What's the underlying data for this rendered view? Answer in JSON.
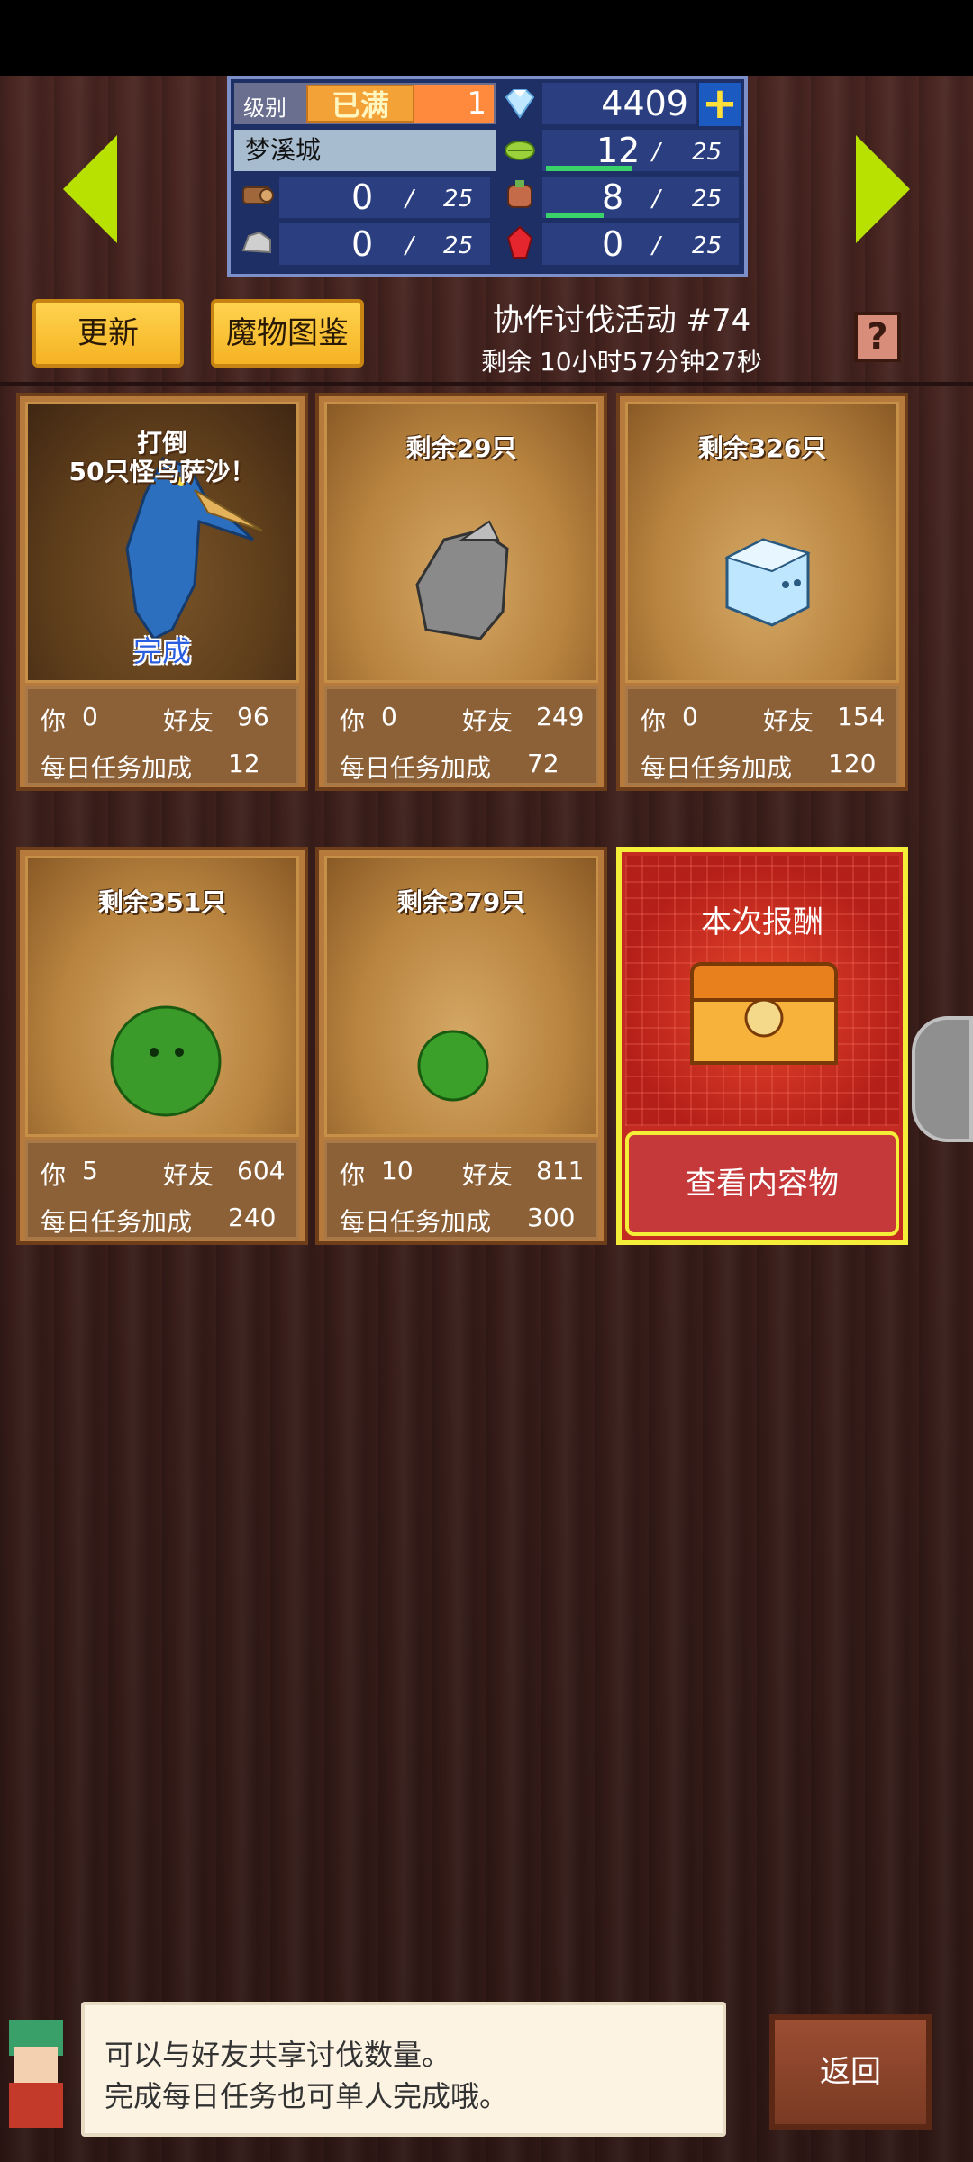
{
  "header": {
    "level_label": "级别",
    "level_status": "已满",
    "level_value": "1",
    "gems": "4409",
    "city": "梦溪城",
    "resources": [
      {
        "name": "wood",
        "current": "0",
        "max": "25"
      },
      {
        "name": "herb",
        "current": "12",
        "max": "25",
        "fill": 0.48
      },
      {
        "name": "ore",
        "current": "0",
        "max": "25"
      },
      {
        "name": "meat",
        "current": "8",
        "max": "25",
        "fill": 0.32
      },
      {
        "name": "stone",
        "current": "0",
        "max": "25"
      },
      {
        "name": "ruby",
        "current": "0",
        "max": "25"
      }
    ]
  },
  "toolbar": {
    "refresh_label": "更新",
    "monster_book_label": "魔物图鉴",
    "event_title": "协作讨伐活动 #74",
    "event_time": "剩余 10小时57分钟27秒",
    "help_label": "?"
  },
  "cards": [
    {
      "title": "打倒\n50只怪鸟萨沙！",
      "title_l1": "打倒",
      "title_l2": "50只怪鸟萨沙！",
      "done": "完成",
      "you_label": "你",
      "you": "0",
      "friend_label": "好友",
      "friend": "96",
      "daily_label": "每日任务加成",
      "daily": "12"
    },
    {
      "title": "剩余29只",
      "you_label": "你",
      "you": "0",
      "friend_label": "好友",
      "friend": "249",
      "daily_label": "每日任务加成",
      "daily": "72"
    },
    {
      "title": "剩余326只",
      "you_label": "你",
      "you": "0",
      "friend_label": "好友",
      "friend": "154",
      "daily_label": "每日任务加成",
      "daily": "120"
    },
    {
      "title": "剩余351只",
      "you_label": "你",
      "you": "5",
      "friend_label": "好友",
      "friend": "604",
      "daily_label": "每日任务加成",
      "daily": "240"
    },
    {
      "title": "剩余379只",
      "you_label": "你",
      "you": "10",
      "friend_label": "好友",
      "friend": "811",
      "daily_label": "每日任务加成",
      "daily": "300"
    }
  ],
  "reward": {
    "title": "本次报酬",
    "button": "查看内容物"
  },
  "tip": {
    "line1": "可以与好友共享讨伐数量。",
    "line2": "完成每日任务也可单人完成哦。"
  },
  "back_label": "返回",
  "colors": {
    "accent_yellow": "#f5b323",
    "reward_red": "#c22a22",
    "bar_green": "#3ad36a"
  }
}
